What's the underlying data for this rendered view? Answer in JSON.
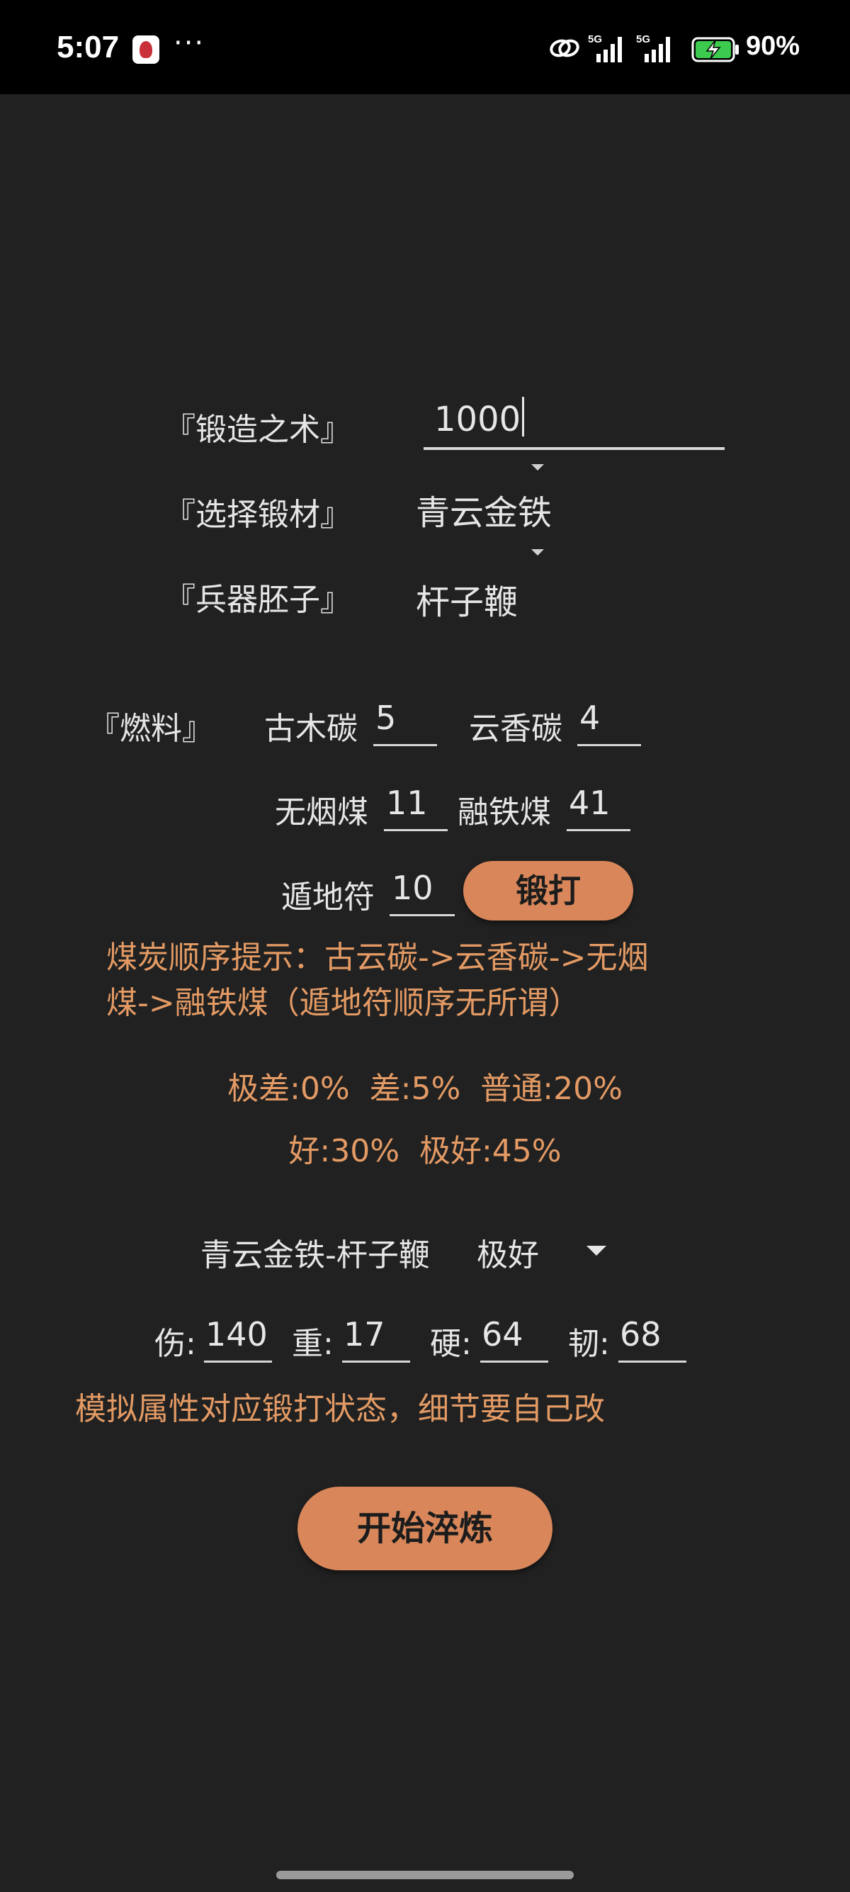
{
  "status_bar": {
    "time": "5:07",
    "dots": "···",
    "battery": "90%",
    "icons": [
      "avatar-icon",
      "link-icon",
      "signal-5g-icon",
      "signal-5g-icon",
      "battery-charging-icon"
    ]
  },
  "forge": {
    "skill_label": "『锻造之术』",
    "skill_value": "1000",
    "material_label": "『选择锻材』",
    "material_value": "青云金铁",
    "blank_label": "『兵器胚子』",
    "blank_value": "杆子鞭"
  },
  "fuel": {
    "label": "『燃料』",
    "items": [
      {
        "name": "古木碳",
        "value": "5"
      },
      {
        "name": "云香碳",
        "value": "4"
      },
      {
        "name": "无烟煤",
        "value": "11"
      },
      {
        "name": "融铁煤",
        "value": "41"
      },
      {
        "name": "遁地符",
        "value": "10"
      }
    ]
  },
  "forge_button": "锻打",
  "hint": {
    "line1": "煤炭顺序提示：古云碳->云香碳->无烟",
    "line2": "煤->融铁煤（遁地符顺序无所谓）"
  },
  "odds": {
    "line1": "极差:0%  差:5%  普通:20%",
    "line2": "好:30%  极好:45%"
  },
  "result": {
    "item": "青云金铁-杆子鞭",
    "quality": "极好"
  },
  "stats": [
    {
      "label": "伤:",
      "value": "140"
    },
    {
      "label": "重:",
      "value": "17"
    },
    {
      "label": "硬:",
      "value": "64"
    },
    {
      "label": "韧:",
      "value": "68"
    }
  ],
  "note": "模拟属性对应锻打状态，细节要自己改",
  "start_button": "开始淬炼",
  "colors": {
    "background": "#212121",
    "accent": "#d9875a",
    "hint_text": "#e39a64"
  }
}
